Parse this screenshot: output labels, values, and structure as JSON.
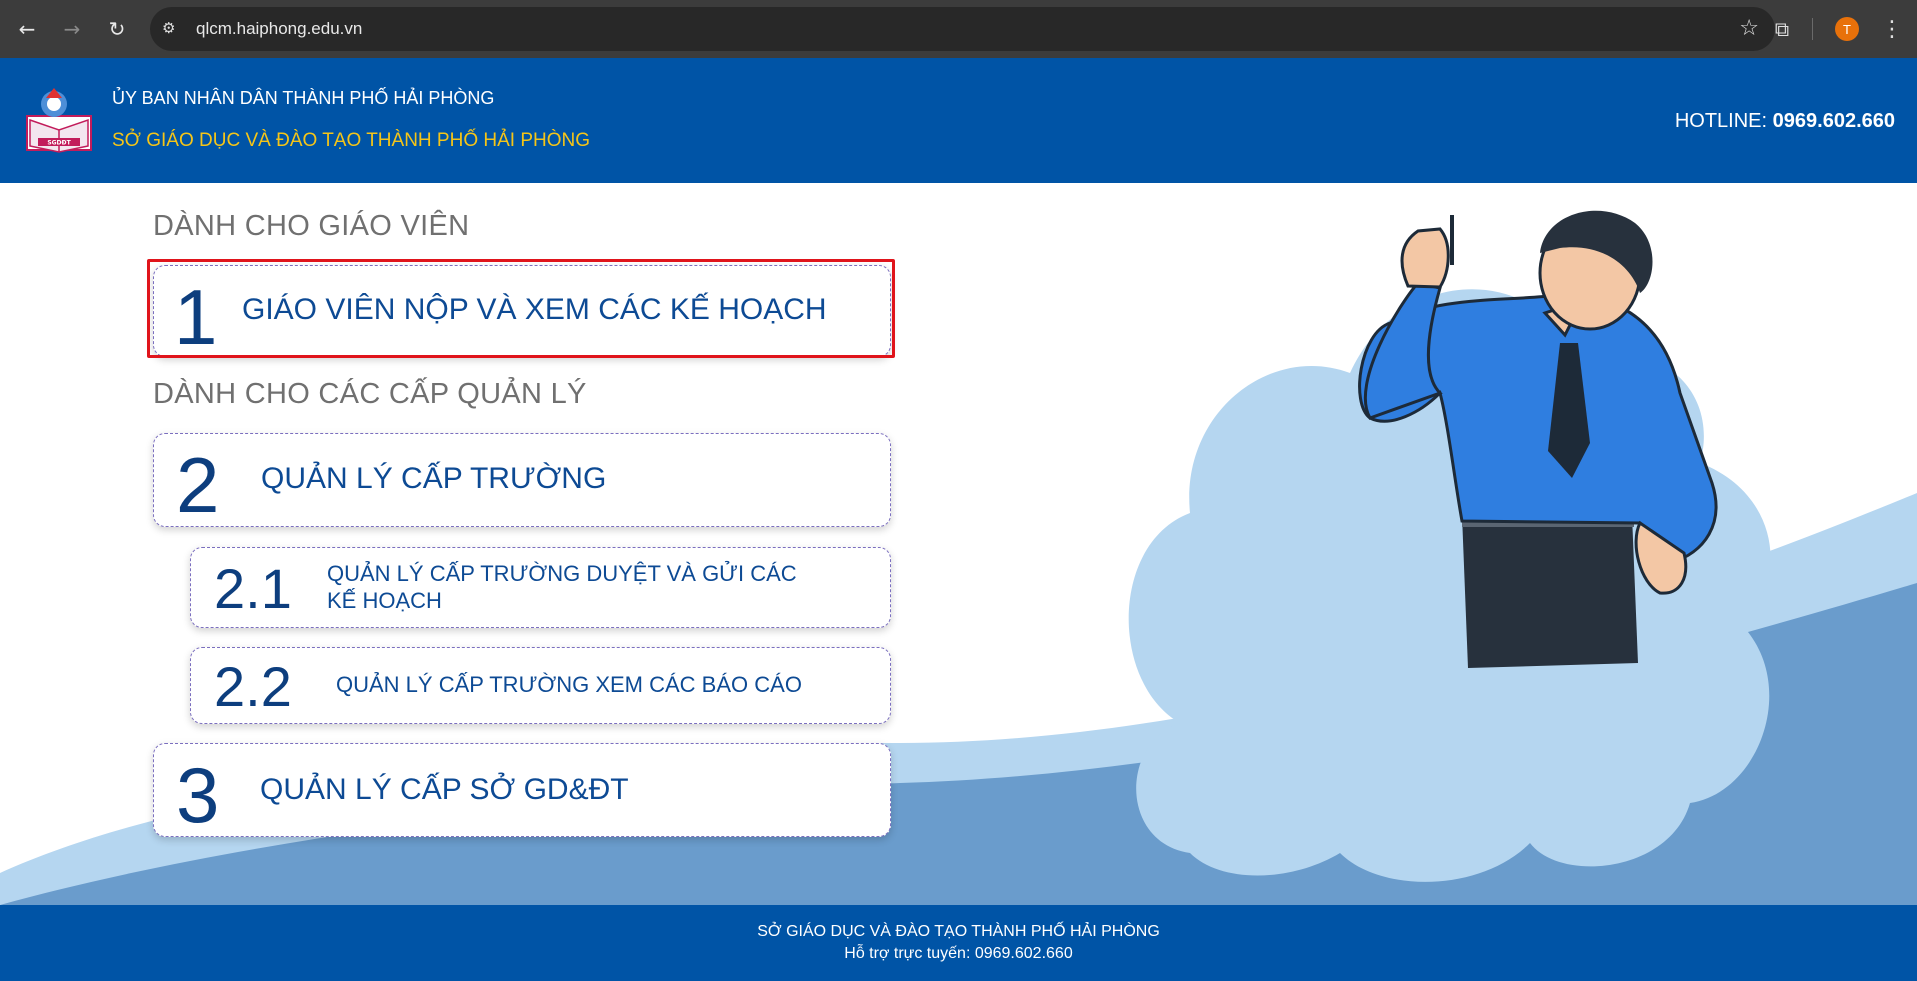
{
  "browser": {
    "url": "qlcm.haiphong.edu.vn",
    "profile_initial": "T",
    "icons": [
      "back-icon",
      "forward-icon",
      "reload-icon",
      "site-info-icon",
      "star-icon",
      "extensions-icon",
      "menu-icon"
    ]
  },
  "header": {
    "org_line1": "ỦY BAN NHÂN DÂN THÀNH PHỐ HẢI PHÒNG",
    "org_line2": "SỞ GIÁO DỤC VÀ ĐÀO TẠO THÀNH PHỐ HẢI PHÒNG",
    "hotline_label": "HOTLINE:",
    "hotline_number": "0969.602.660",
    "logo_text": "SGDĐT"
  },
  "main": {
    "teacher_section_title": "DÀNH CHO GIÁO VIÊN",
    "manager_section_title": "DÀNH CHO CÁC CẤP QUẢN LÝ",
    "cards": [
      {
        "num": "1",
        "label": "GIÁO VIÊN NỘP VÀ XEM CÁC KẾ HOẠCH"
      },
      {
        "num": "2",
        "label": "QUẢN LÝ CẤP TRƯỜNG"
      },
      {
        "num": "2.1",
        "label": "QUẢN LÝ CẤP TRƯỜNG DUYỆT VÀ GỬI CÁC KẾ HOẠCH"
      },
      {
        "num": "2.2",
        "label": "QUẢN LÝ CẤP TRƯỜNG XEM CÁC BÁO CÁO"
      },
      {
        "num": "3",
        "label": "QUẢN LÝ CẤP SỞ GD&ĐT"
      }
    ]
  },
  "footer": {
    "line1": "SỞ GIÁO DỤC VÀ ĐÀO TẠO THÀNH PHỐ HẢI PHÒNG",
    "line2": "Hỗ trợ trực tuyến: 0969.602.660"
  },
  "colors": {
    "header_bg": "#0054a6",
    "hotline_text": "#ffffff",
    "org_line2_text": "#f5c518",
    "card_number": "#0d3e7e",
    "highlight_border": "#e0141b",
    "wave_light": "#b5d6f0",
    "wave_dark": "#6a9ccc"
  }
}
